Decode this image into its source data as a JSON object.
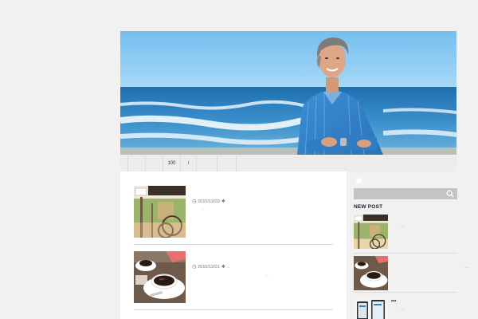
{
  "navbar": {
    "items": [
      "",
      "",
      "",
      "100",
      "/",
      "",
      ""
    ]
  },
  "posts": [
    {
      "date": "2015/12/03",
      "tag": "",
      "excerpt": "…"
    },
    {
      "date": "2015/12/01",
      "tag": "..",
      "excerpt": "…"
    }
  ],
  "sidebar": {
    "widget_title": "NEW POST",
    "items": [
      {
        "text": "…"
      },
      {
        "text": "…"
      },
      {
        "title": "•••",
        "text": "…"
      }
    ]
  },
  "colors": {
    "page_bg": "#f1f1f1",
    "sky": "#7ec4ef",
    "sea": "#2e86c4",
    "search_bar": "#c4c4c4"
  },
  "icons": {
    "date": "clock-icon",
    "tag": "tag-icon",
    "search": "search-icon"
  }
}
